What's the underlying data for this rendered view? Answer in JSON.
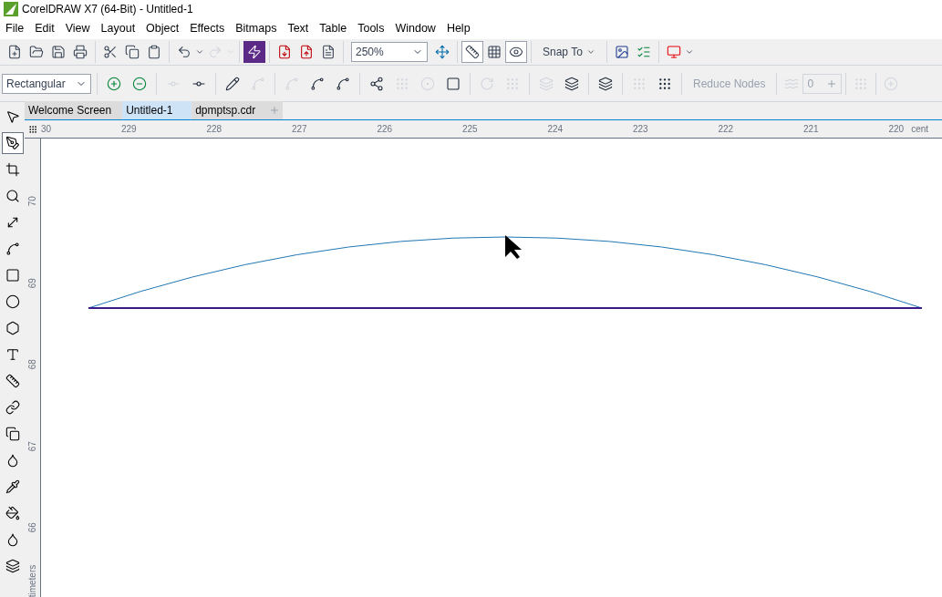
{
  "window": {
    "title": "CorelDRAW X7 (64-Bit) - Untitled-1"
  },
  "menu": [
    "File",
    "Edit",
    "View",
    "Layout",
    "Object",
    "Effects",
    "Bitmaps",
    "Text",
    "Table",
    "Tools",
    "Window",
    "Help"
  ],
  "toolbar": {
    "zoom": "250%",
    "snap": "Snap To",
    "toggles": [
      {
        "selected": true
      },
      {
        "selected": false
      },
      {
        "selected": true
      }
    ]
  },
  "property_bar": {
    "selection_mode": "Rectangular",
    "icons_disabled": [
      false,
      false,
      true,
      false,
      false,
      true,
      true,
      false,
      false,
      false,
      true,
      true,
      false,
      true,
      true,
      true,
      false,
      false,
      true,
      false
    ],
    "reduce_nodes": {
      "label": "Reduce Nodes",
      "disabled": true
    },
    "smoothness": "0"
  },
  "tabs": [
    {
      "label": "Welcome Screen",
      "selected": false
    },
    {
      "label": "Untitled-1",
      "selected": true
    },
    {
      "label": "dpmptsp.cdr",
      "selected": false
    }
  ],
  "ruler_h": [
    "30",
    "229",
    "228",
    "227",
    "226",
    "225",
    "224",
    "223",
    "222",
    "221",
    "220"
  ],
  "ruler_h_unit": "cent",
  "ruler_v": [
    "70",
    "69",
    "68",
    "67",
    "66"
  ],
  "ruler_v_unit": "timeters",
  "tools": [
    {
      "selected": false
    },
    {
      "selected": true
    },
    {
      "selected": false
    },
    {
      "selected": false
    },
    {
      "selected": false
    },
    {
      "selected": false
    },
    {
      "selected": false
    },
    {
      "selected": false
    },
    {
      "selected": false
    },
    {
      "selected": false
    },
    {
      "selected": false
    },
    {
      "selected": false
    },
    {
      "selected": false
    },
    {
      "selected": false
    },
    {
      "selected": false
    },
    {
      "selected": false
    },
    {
      "selected": false
    },
    {
      "selected": false
    }
  ]
}
